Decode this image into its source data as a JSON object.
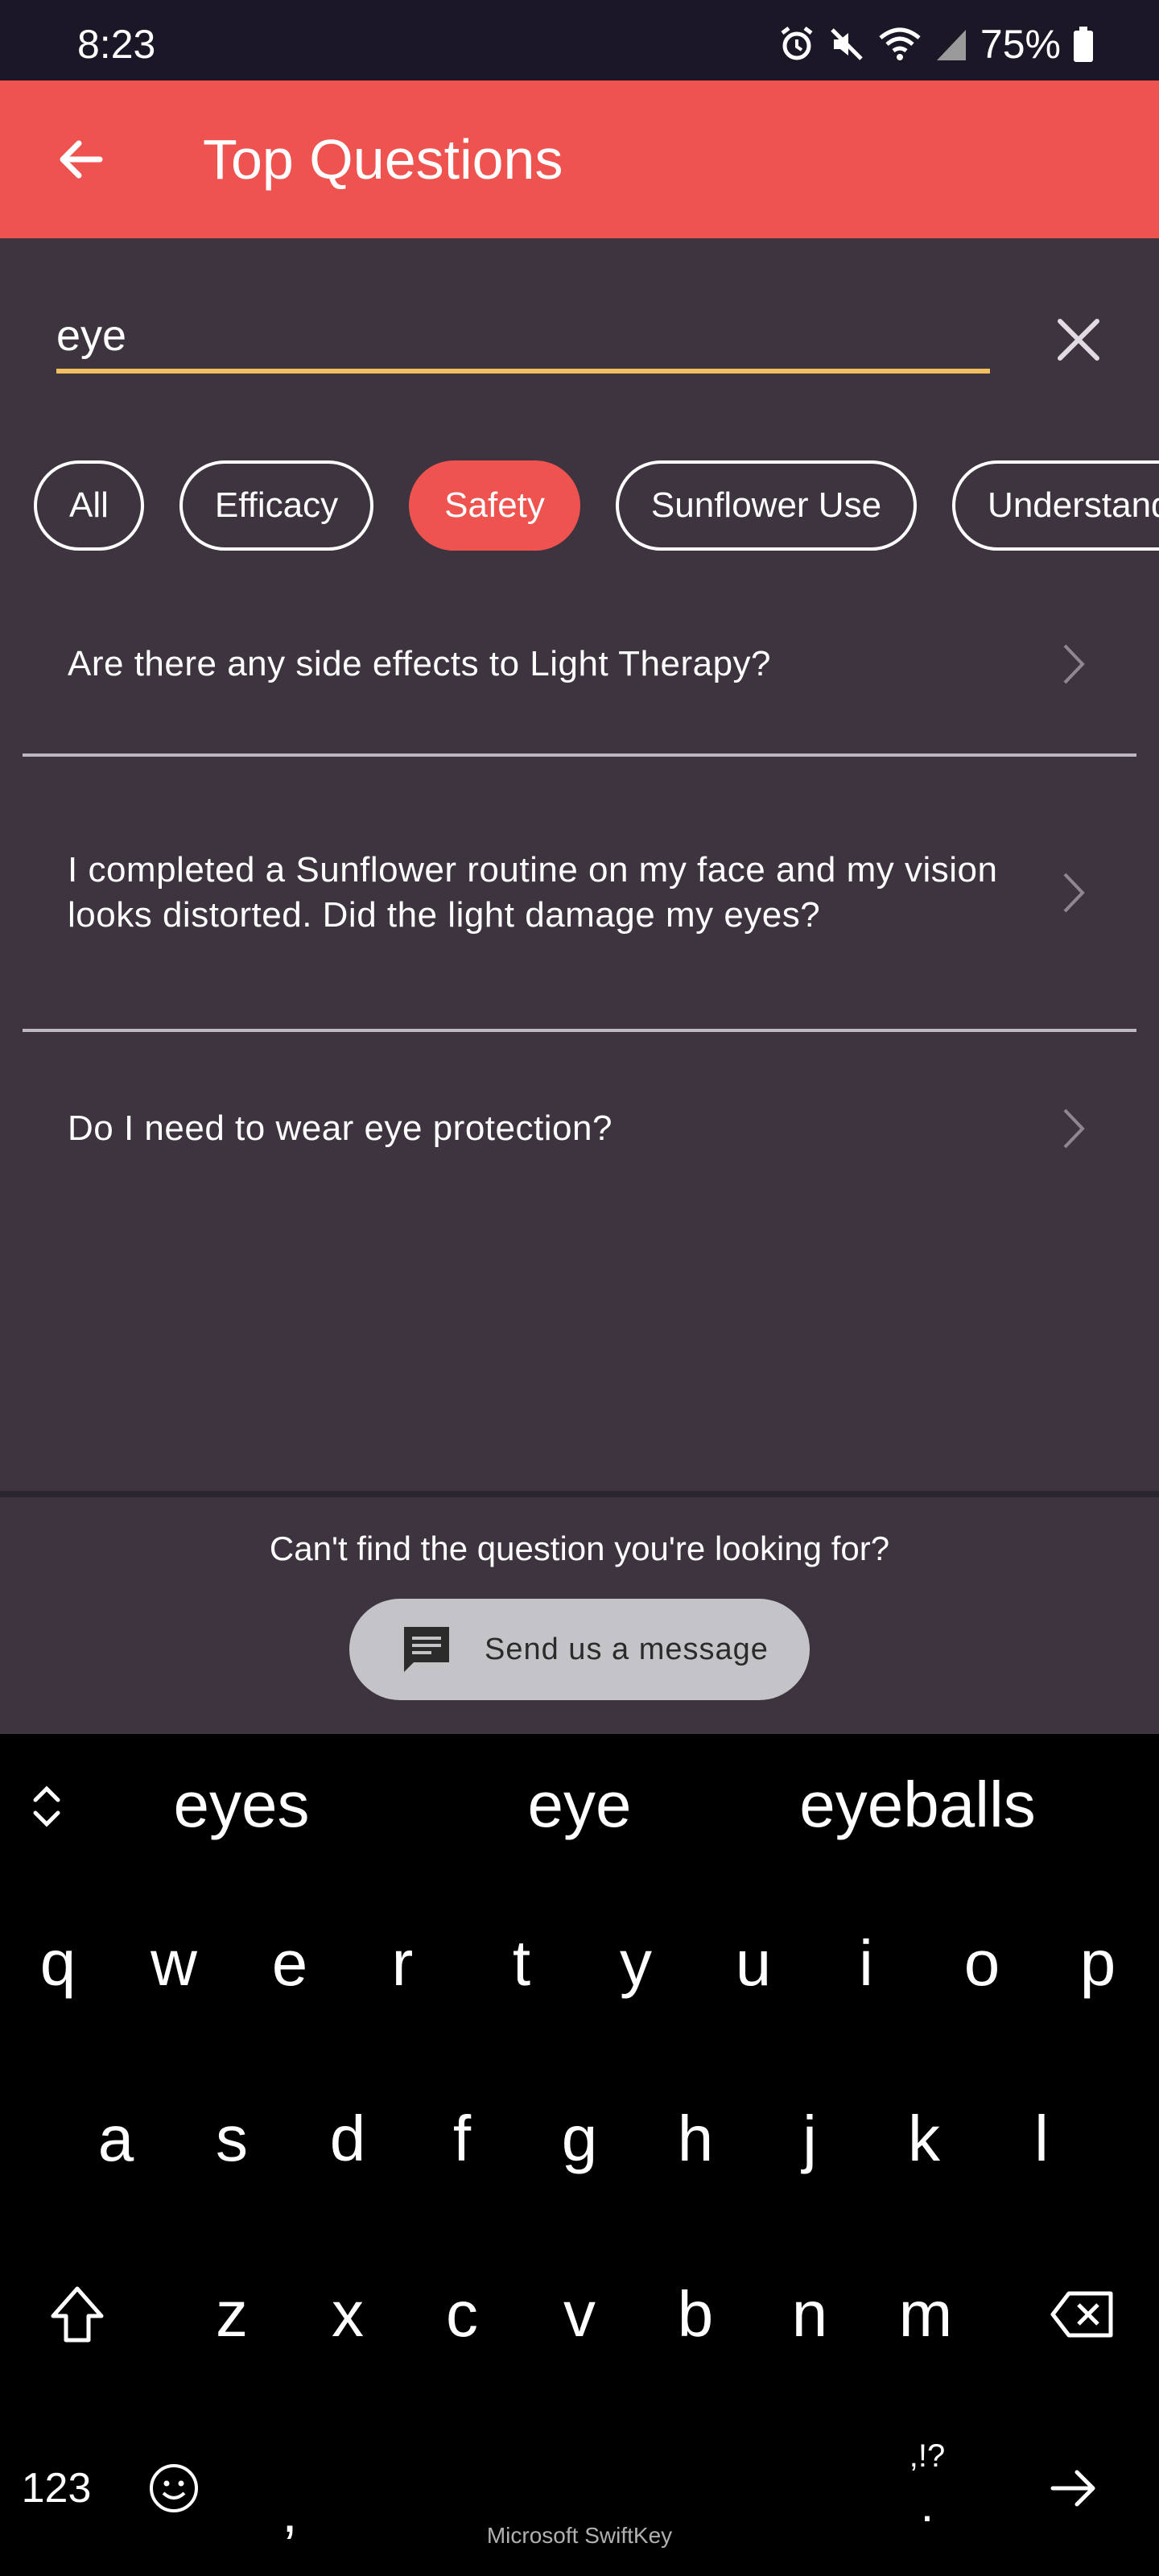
{
  "status_bar": {
    "time": "8:23",
    "battery": "75%",
    "icons": [
      "alarm-icon",
      "mute-icon",
      "wifi-icon",
      "signal-icon",
      "battery-icon"
    ]
  },
  "app_bar": {
    "title": "Top Questions",
    "back_icon": "arrow-left-icon",
    "color": "#ef5350"
  },
  "search": {
    "value": "eye",
    "clear_icon": "close-icon",
    "underline_color": "#f0c060"
  },
  "chips": [
    {
      "label": "All",
      "active": false
    },
    {
      "label": "Efficacy",
      "active": false
    },
    {
      "label": "Safety",
      "active": true
    },
    {
      "label": "Sunflower Use",
      "active": false
    },
    {
      "label": "Understandin",
      "active": false
    }
  ],
  "questions": [
    {
      "text": "Are there any side effects to Light Therapy?"
    },
    {
      "text": "I completed a Sunflower routine on my face and my vision looks distorted. Did the light damage my eyes?"
    },
    {
      "text": "Do I need to wear eye protection?"
    }
  ],
  "help": {
    "prompt": "Can't find the question you're looking for?",
    "button_label": "Send us a message",
    "button_icon": "message-icon"
  },
  "keyboard": {
    "suggestions": [
      "eyes",
      "eye",
      "eyeballs"
    ],
    "row1": [
      "q",
      "w",
      "e",
      "r",
      "t",
      "y",
      "u",
      "i",
      "o",
      "p"
    ],
    "row2": [
      "a",
      "s",
      "d",
      "f",
      "g",
      "h",
      "j",
      "k",
      "l"
    ],
    "row3": [
      "z",
      "x",
      "c",
      "v",
      "b",
      "n",
      "m"
    ],
    "numbers_key": "123",
    "comma_key": ",",
    "punct_hint": ",!?",
    "period_key": ".",
    "brand": "Microsoft SwiftKey"
  },
  "colors": {
    "status_bar": "#1c1727",
    "content_bg": "#3e3440",
    "keyboard_bg": "#000000",
    "chip_active": "#ef5350"
  }
}
